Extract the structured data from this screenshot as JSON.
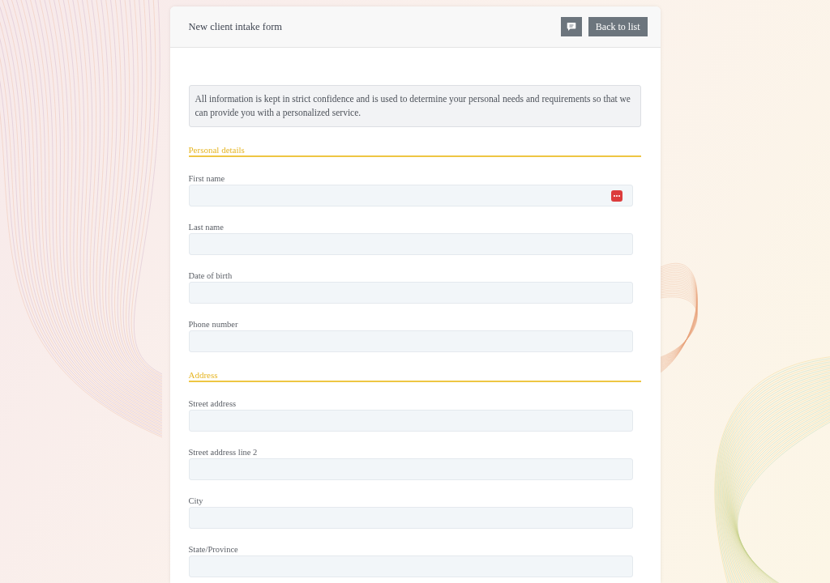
{
  "header": {
    "title": "New client intake form",
    "buttons": [
      {
        "kind": "icon"
      },
      {
        "kind": "text",
        "label": "Back to list"
      }
    ]
  },
  "notice": "All information is kept in strict confidence and is used to determine your personal needs and requirements so that we can provide you with a personalized service.",
  "sections": [
    {
      "title": "Personal details",
      "fields": [
        {
          "label": "First name",
          "badge": true
        },
        {
          "label": "Last name",
          "badge": false
        },
        {
          "label": "Date of birth",
          "badge": false
        },
        {
          "label": "Phone number",
          "badge": false
        }
      ]
    },
    {
      "title": "Address",
      "fields": [
        {
          "label": "Street address",
          "badge": false
        },
        {
          "label": "Street address line 2",
          "badge": false
        },
        {
          "label": "City",
          "badge": false
        },
        {
          "label": "State/Province",
          "badge": false
        }
      ]
    }
  ]
}
